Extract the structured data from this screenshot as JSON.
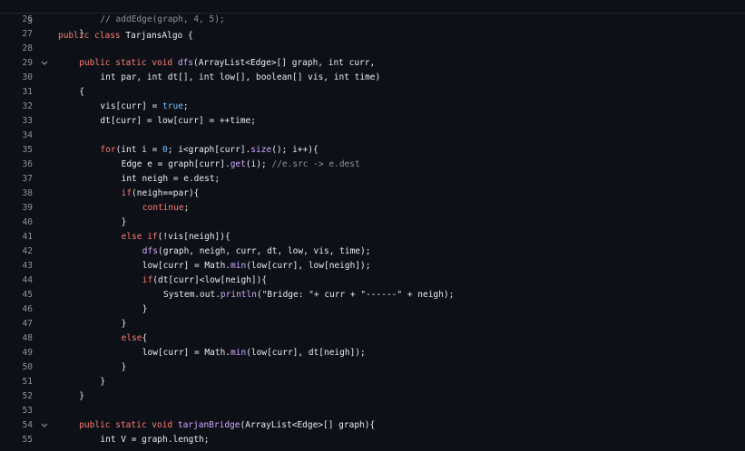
{
  "sticky_header": {
    "line_number": "3",
    "tokens": [
      {
        "t": "public class ",
        "c": "kw"
      },
      {
        "t": "TarjansAlgo {",
        "c": ""
      }
    ]
  },
  "lines": [
    {
      "n": "26",
      "fold": false,
      "indent": 8,
      "tokens": [
        {
          "t": "// addEdge(graph, 4, 5);",
          "c": "cm"
        }
      ]
    },
    {
      "n": "27",
      "fold": false,
      "indent": 4,
      "tokens": [
        {
          "t": "}",
          "c": ""
        }
      ]
    },
    {
      "n": "28",
      "fold": false,
      "indent": 0,
      "tokens": []
    },
    {
      "n": "29",
      "fold": true,
      "indent": 4,
      "tokens": [
        {
          "t": "public static void ",
          "c": "kw"
        },
        {
          "t": "dfs",
          "c": "fn"
        },
        {
          "t": "(ArrayList<Edge>[] graph, int curr,",
          "c": ""
        }
      ]
    },
    {
      "n": "30",
      "fold": false,
      "indent": 8,
      "tokens": [
        {
          "t": "int par, int dt[], int low[], boolean[] vis, int time)",
          "c": ""
        }
      ]
    },
    {
      "n": "31",
      "fold": false,
      "indent": 4,
      "tokens": [
        {
          "t": "{",
          "c": ""
        }
      ]
    },
    {
      "n": "32",
      "fold": false,
      "indent": 8,
      "tokens": [
        {
          "t": "vis[curr] = ",
          "c": ""
        },
        {
          "t": "true",
          "c": "num"
        },
        {
          "t": ";",
          "c": ""
        }
      ]
    },
    {
      "n": "33",
      "fold": false,
      "indent": 8,
      "tokens": [
        {
          "t": "dt[curr] = low[curr] = ++time;",
          "c": ""
        }
      ]
    },
    {
      "n": "34",
      "fold": false,
      "indent": 0,
      "tokens": []
    },
    {
      "n": "35",
      "fold": false,
      "indent": 8,
      "tokens": [
        {
          "t": "for",
          "c": "kw"
        },
        {
          "t": "(int i = ",
          "c": ""
        },
        {
          "t": "0",
          "c": "num"
        },
        {
          "t": "; i<graph[curr].",
          "c": ""
        },
        {
          "t": "size",
          "c": "fn"
        },
        {
          "t": "(); i++){",
          "c": ""
        }
      ]
    },
    {
      "n": "36",
      "fold": false,
      "indent": 12,
      "tokens": [
        {
          "t": "Edge e = graph[curr].",
          "c": ""
        },
        {
          "t": "get",
          "c": "fn"
        },
        {
          "t": "(i); ",
          "c": ""
        },
        {
          "t": "//e.src -> e.dest",
          "c": "cm"
        }
      ]
    },
    {
      "n": "37",
      "fold": false,
      "indent": 12,
      "tokens": [
        {
          "t": "int neigh = e.dest;",
          "c": ""
        }
      ]
    },
    {
      "n": "38",
      "fold": false,
      "indent": 12,
      "tokens": [
        {
          "t": "if",
          "c": "kw"
        },
        {
          "t": "(neigh==par){",
          "c": ""
        }
      ]
    },
    {
      "n": "39",
      "fold": false,
      "indent": 16,
      "tokens": [
        {
          "t": "continue",
          "c": "kw"
        },
        {
          "t": ";",
          "c": ""
        }
      ]
    },
    {
      "n": "40",
      "fold": false,
      "indent": 12,
      "tokens": [
        {
          "t": "}",
          "c": ""
        }
      ]
    },
    {
      "n": "41",
      "fold": false,
      "indent": 12,
      "tokens": [
        {
          "t": "else if",
          "c": "kw"
        },
        {
          "t": "(!vis[neigh]){",
          "c": ""
        }
      ]
    },
    {
      "n": "42",
      "fold": false,
      "indent": 16,
      "tokens": [
        {
          "t": "dfs",
          "c": "fn"
        },
        {
          "t": "(graph, neigh, curr, dt, low, vis, time);",
          "c": ""
        }
      ]
    },
    {
      "n": "43",
      "fold": false,
      "indent": 16,
      "tokens": [
        {
          "t": "low[curr] = Math.",
          "c": ""
        },
        {
          "t": "min",
          "c": "fn"
        },
        {
          "t": "(low[curr], low[neigh]);",
          "c": ""
        }
      ]
    },
    {
      "n": "44",
      "fold": false,
      "indent": 16,
      "tokens": [
        {
          "t": "if",
          "c": "kw"
        },
        {
          "t": "(dt[curr]<low[neigh]){",
          "c": ""
        }
      ]
    },
    {
      "n": "45",
      "fold": false,
      "indent": 20,
      "tokens": [
        {
          "t": "System.out.",
          "c": ""
        },
        {
          "t": "println",
          "c": "fn"
        },
        {
          "t": "(\"Bridge: \"+ curr + \"------\" + neigh);",
          "c": ""
        }
      ]
    },
    {
      "n": "46",
      "fold": false,
      "indent": 16,
      "tokens": [
        {
          "t": "}",
          "c": ""
        }
      ]
    },
    {
      "n": "47",
      "fold": false,
      "indent": 12,
      "tokens": [
        {
          "t": "}",
          "c": ""
        }
      ]
    },
    {
      "n": "48",
      "fold": false,
      "indent": 12,
      "tokens": [
        {
          "t": "else",
          "c": "kw"
        },
        {
          "t": "{",
          "c": ""
        }
      ]
    },
    {
      "n": "49",
      "fold": false,
      "indent": 16,
      "tokens": [
        {
          "t": "low[curr] = Math.",
          "c": ""
        },
        {
          "t": "min",
          "c": "fn"
        },
        {
          "t": "(low[curr], dt[neigh]);",
          "c": ""
        }
      ]
    },
    {
      "n": "50",
      "fold": false,
      "indent": 12,
      "tokens": [
        {
          "t": "}",
          "c": ""
        }
      ]
    },
    {
      "n": "51",
      "fold": false,
      "indent": 8,
      "tokens": [
        {
          "t": "}",
          "c": ""
        }
      ]
    },
    {
      "n": "52",
      "fold": false,
      "indent": 4,
      "tokens": [
        {
          "t": "}",
          "c": ""
        }
      ]
    },
    {
      "n": "53",
      "fold": false,
      "indent": 0,
      "tokens": []
    },
    {
      "n": "54",
      "fold": true,
      "indent": 4,
      "tokens": [
        {
          "t": "public static void ",
          "c": "kw"
        },
        {
          "t": "tarjanBridge",
          "c": "fn"
        },
        {
          "t": "(ArrayList<Edge>[] graph){",
          "c": ""
        }
      ]
    },
    {
      "n": "55",
      "fold": false,
      "indent": 8,
      "tokens": [
        {
          "t": "int V = graph.length;",
          "c": ""
        }
      ]
    }
  ],
  "fold_glyph": "chevron-down-icon",
  "colors": {
    "background": "#0d1117",
    "text": "#e6edf3",
    "keyword": "#ff7b72",
    "function": "#d2a8ff",
    "comment": "#8b949e",
    "constant": "#79c0ff",
    "line_number": "#8b949e"
  }
}
